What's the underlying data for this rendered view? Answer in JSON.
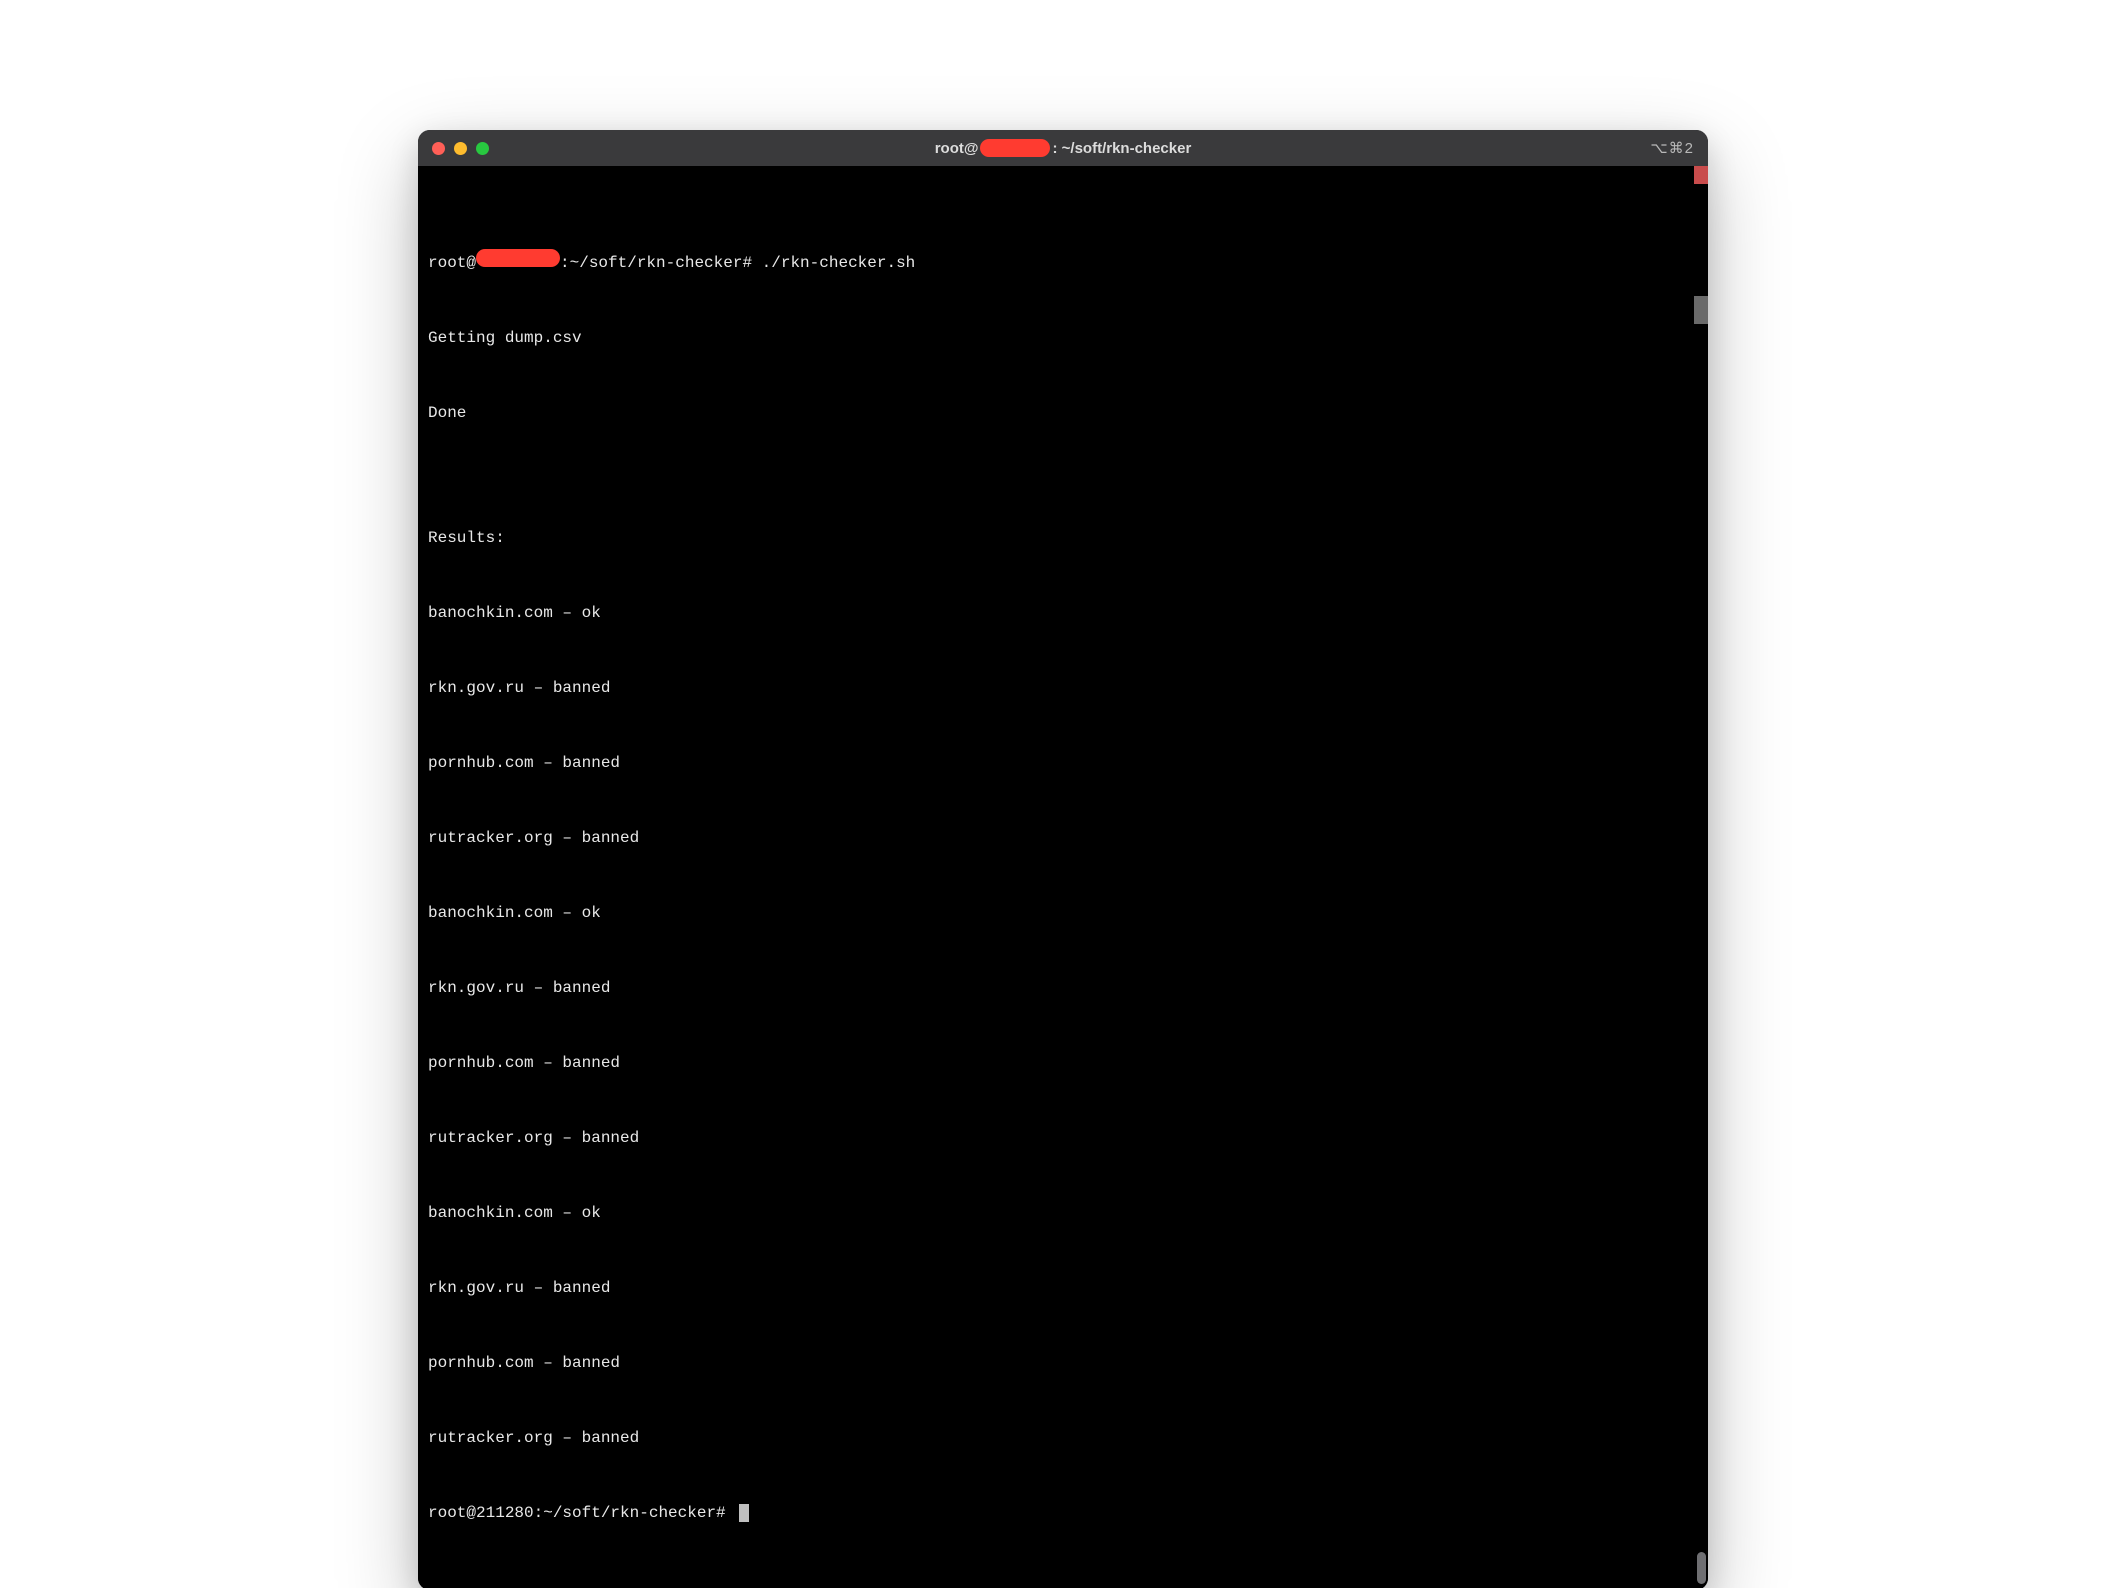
{
  "titlebar": {
    "title_prefix": "root@",
    "title_suffix": ": ~/soft/rkn-checker",
    "shortcut_label": "⌥⌘2"
  },
  "terminal": {
    "prompt1_prefix": "root@",
    "prompt1_suffix": ":~/soft/rkn-checker# ./rkn-checker.sh",
    "lines": [
      "Getting dump.csv",
      "Done",
      "",
      "Results:",
      "banochkin.com – ok",
      "rkn.gov.ru – banned",
      "pornhub.com – banned",
      "rutracker.org – banned",
      "banochkin.com – ok",
      "rkn.gov.ru – banned",
      "pornhub.com – banned",
      "rutracker.org – banned",
      "banochkin.com – ok",
      "rkn.gov.ru – banned",
      "pornhub.com – banned",
      "rutracker.org – banned"
    ],
    "prompt2": "root@211280:~/soft/rkn-checker# "
  }
}
